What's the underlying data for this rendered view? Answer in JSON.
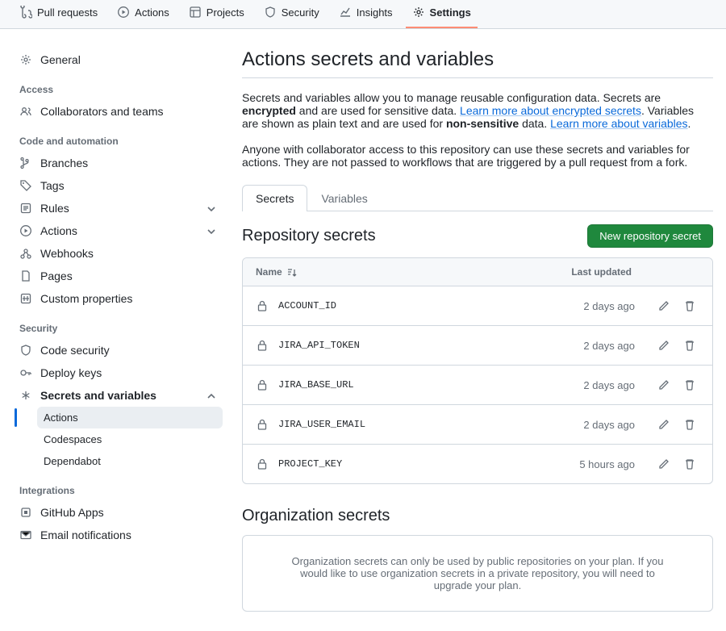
{
  "nav": {
    "pull": "Pull requests",
    "actions": "Actions",
    "projects": "Projects",
    "security": "Security",
    "insights": "Insights",
    "settings": "Settings"
  },
  "sidebar": {
    "general": "General",
    "group_access": "Access",
    "collab": "Collaborators and teams",
    "group_code": "Code and automation",
    "branches": "Branches",
    "tags": "Tags",
    "rules": "Rules",
    "actions": "Actions",
    "webhooks": "Webhooks",
    "pages": "Pages",
    "custom": "Custom properties",
    "group_security": "Security",
    "codesec": "Code security",
    "deploy": "Deploy keys",
    "secrets": "Secrets and variables",
    "sub_actions": "Actions",
    "sub_codespaces": "Codespaces",
    "sub_dependabot": "Dependabot",
    "group_integrations": "Integrations",
    "ghapps": "GitHub Apps",
    "email": "Email notifications"
  },
  "page": {
    "title": "Actions secrets and variables",
    "desc1a": "Secrets and variables allow you to manage reusable configuration data. Secrets are ",
    "desc1b": "encrypted",
    "desc1c": " and are used for sensitive data. ",
    "link1": "Learn more about encrypted secrets",
    "desc1d": ". Variables are shown as plain text and are used for ",
    "desc1e": "non-sensitive",
    "desc1f": " data. ",
    "link2": "Learn more about variables",
    "desc1g": ".",
    "desc2": "Anyone with collaborator access to this repository can use these secrets and variables for actions. They are not passed to workflows that are triggered by a pull request from a fork.",
    "tab_secrets": "Secrets",
    "tab_vars": "Variables",
    "repo_secrets": "Repository secrets",
    "new_btn": "New repository secret",
    "col_name": "Name",
    "col_updated": "Last updated",
    "rows": [
      {
        "name": "ACCOUNT_ID",
        "updated": "2 days ago"
      },
      {
        "name": "JIRA_API_TOKEN",
        "updated": "2 days ago"
      },
      {
        "name": "JIRA_BASE_URL",
        "updated": "2 days ago"
      },
      {
        "name": "JIRA_USER_EMAIL",
        "updated": "2 days ago"
      },
      {
        "name": "PROJECT_KEY",
        "updated": "5 hours ago"
      }
    ],
    "org_title": "Organization secrets",
    "org_msg": "Organization secrets can only be used by public repositories on your plan. If you would like to use organization secrets in a private repository, you will need to upgrade your plan."
  }
}
